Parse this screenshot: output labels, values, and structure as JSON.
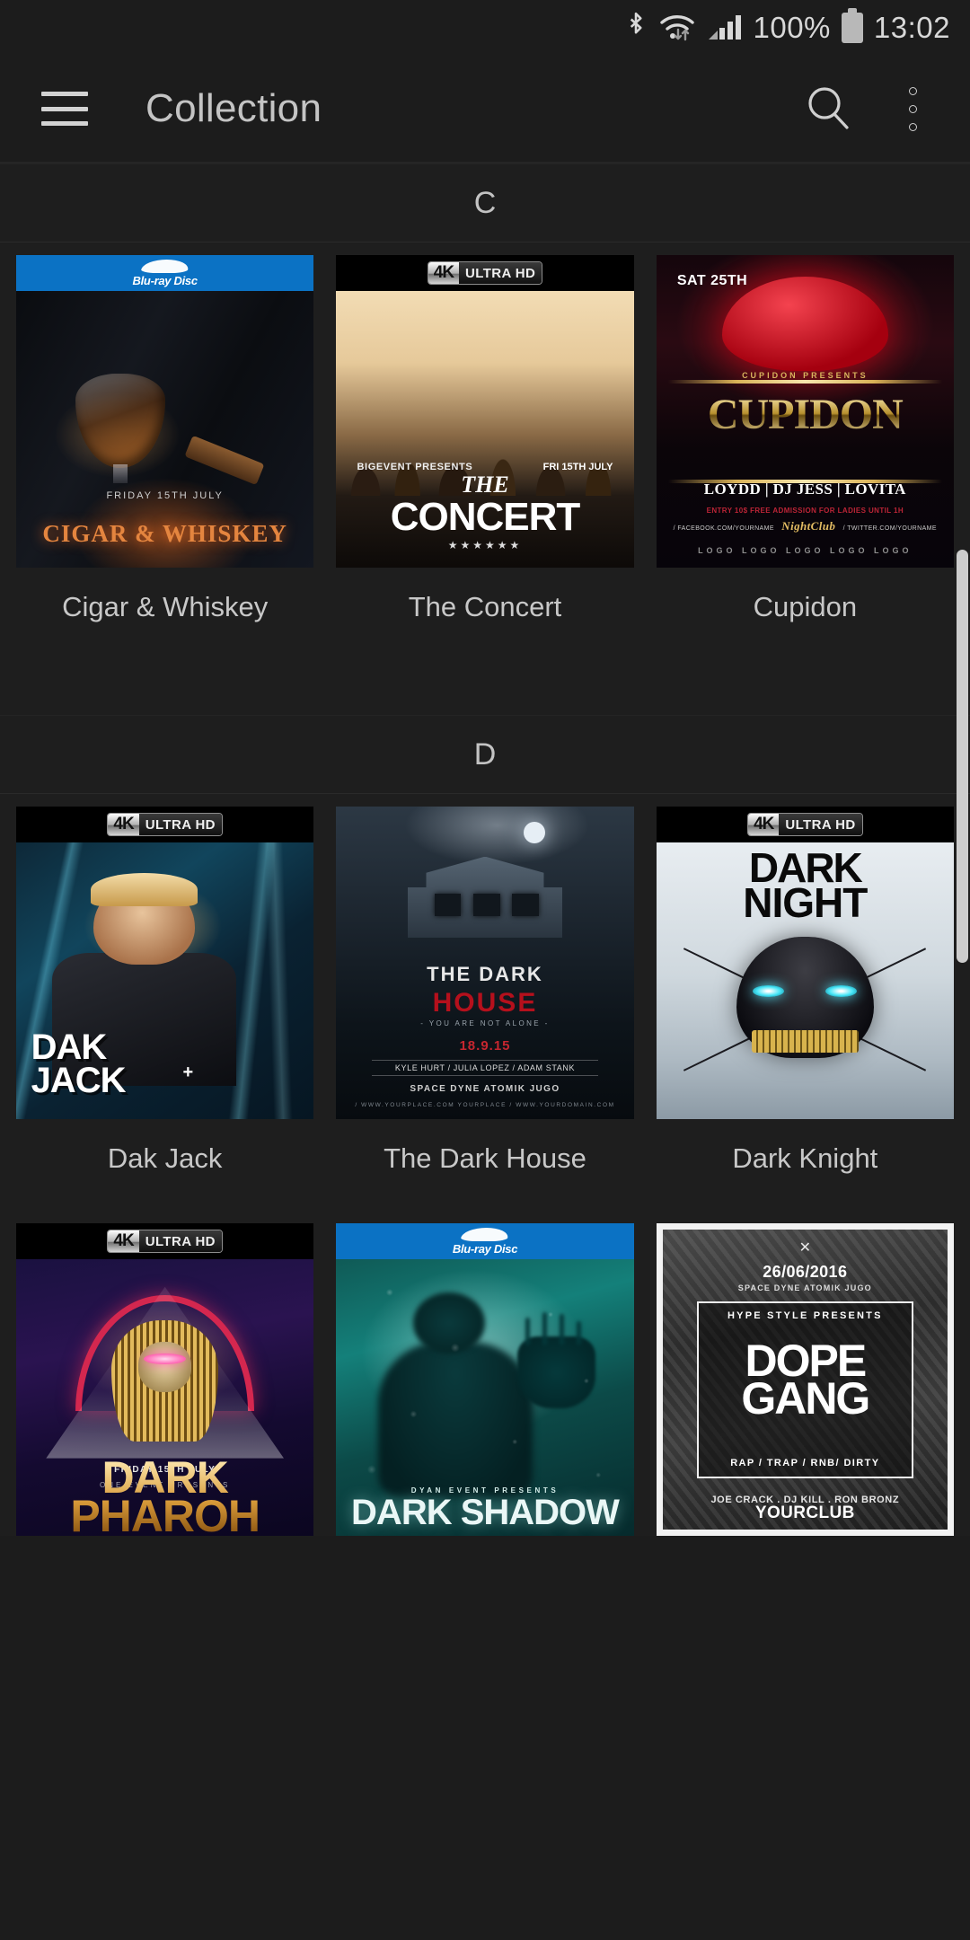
{
  "status_bar": {
    "icons": [
      "bluetooth-icon",
      "wifi-icon",
      "cellular-signal-icon"
    ],
    "battery_percent": "100%",
    "time": "13:02"
  },
  "app_bar": {
    "menu_icon": "hamburger-menu-icon",
    "title": "Collection",
    "search_icon": "search-icon",
    "overflow_icon": "overflow-menu-icon"
  },
  "sections": [
    {
      "letter": "C",
      "items": [
        {
          "title": "Cigar & Whiskey",
          "format": "Blu-ray Disc",
          "format_type": "bluray",
          "art": {
            "date": "FRIDAY 15TH JULY",
            "headline": "CIGAR & WHISKEY"
          }
        },
        {
          "title": "The Concert",
          "format": "4K UltraHD",
          "format_type": "uhd",
          "art": {
            "presenter": "BIGEVENT PRESENTS",
            "date": "FRI 15TH JULY",
            "the": "THE",
            "headline": "CONCERT",
            "stars": "★★★★★★"
          }
        },
        {
          "title": "Cupidon",
          "format": "none",
          "format_type": "none",
          "art": {
            "day": "SAT 25TH",
            "presents": "CUPIDON PRESENTS",
            "headline": "CUPIDON",
            "djs": "LOYDD | DJ JESS | LOVITA",
            "entry": "ENTRY 10$ FREE ADMISSION FOR LADIES UNTIL 1H",
            "social_left": "/ FACEBOOK.COM/YOURNAME",
            "club": "NightClub",
            "social_right": "/ TWITTER.COM/YOURNAME",
            "logos": "LOGO LOGO LOGO LOGO LOGO"
          }
        }
      ]
    },
    {
      "letter": "D",
      "items": [
        {
          "title": "Dak Jack",
          "format": "4K UltraHD",
          "format_type": "uhd",
          "art": {
            "headline1": "DAK",
            "headline2": "JACK",
            "plus": "+"
          }
        },
        {
          "title": "The Dark House",
          "format": "none",
          "format_type": "none",
          "art": {
            "headline1": "THE DARK",
            "headline2": "HOUSE",
            "tagline": "- YOU ARE NOT ALONE -",
            "date": "18.9.15",
            "cast": "KYLE HURT / JULIA LOPEZ / ADAM STANK",
            "brands": "SPACE  DYNE  ATOMIK  JUGO",
            "site": "/ WWW.YOURPLACE.COM   YOURPLACE   / WWW.YOURDOMAIN.COM"
          }
        },
        {
          "title": "Dark Knight",
          "format": "4K UltraHD",
          "format_type": "uhd",
          "art": {
            "headline1": "DARK",
            "headline2": "NIGHT"
          }
        },
        {
          "title": "Dark Pharoh",
          "format": "4K UltraHD",
          "format_type": "uhd",
          "art": {
            "date": "FRIDAY 15TH JULY",
            "presents": "ONE EVENT PRESENTS",
            "headline1": "DARK",
            "headline2": "PHAROH"
          }
        },
        {
          "title": "Dark Shadow",
          "format": "Blu-ray Disc",
          "format_type": "bluray",
          "art": {
            "presents": "DYAN EVENT PRESENTS",
            "headline": "DARK SHADOW"
          }
        },
        {
          "title": "Dope Gang",
          "format": "none",
          "format_type": "none",
          "art": {
            "x": "✕",
            "date": "26/06/2016",
            "brands": "SPACE  DYNE  ATOMIK  JUGO",
            "hype": "HYPE STYLE PRESENTS",
            "headline1": "DOPE",
            "headline2": "GANG",
            "genres": "RAP / TRAP / RNB/ DIRTY",
            "djs": "JOE CRACK . DJ KILL . RON BRONZ",
            "club": "YOURCLUB"
          }
        }
      ]
    }
  ],
  "scrollbar": {
    "name": "vertical-scrollbar"
  },
  "colors": {
    "background": "#1e1e1e",
    "app_bar": "#1c1c1c",
    "text": "#c8c8c8",
    "bluray_blue": "#0b72c4",
    "scrollbar": "#cdcdcd"
  }
}
